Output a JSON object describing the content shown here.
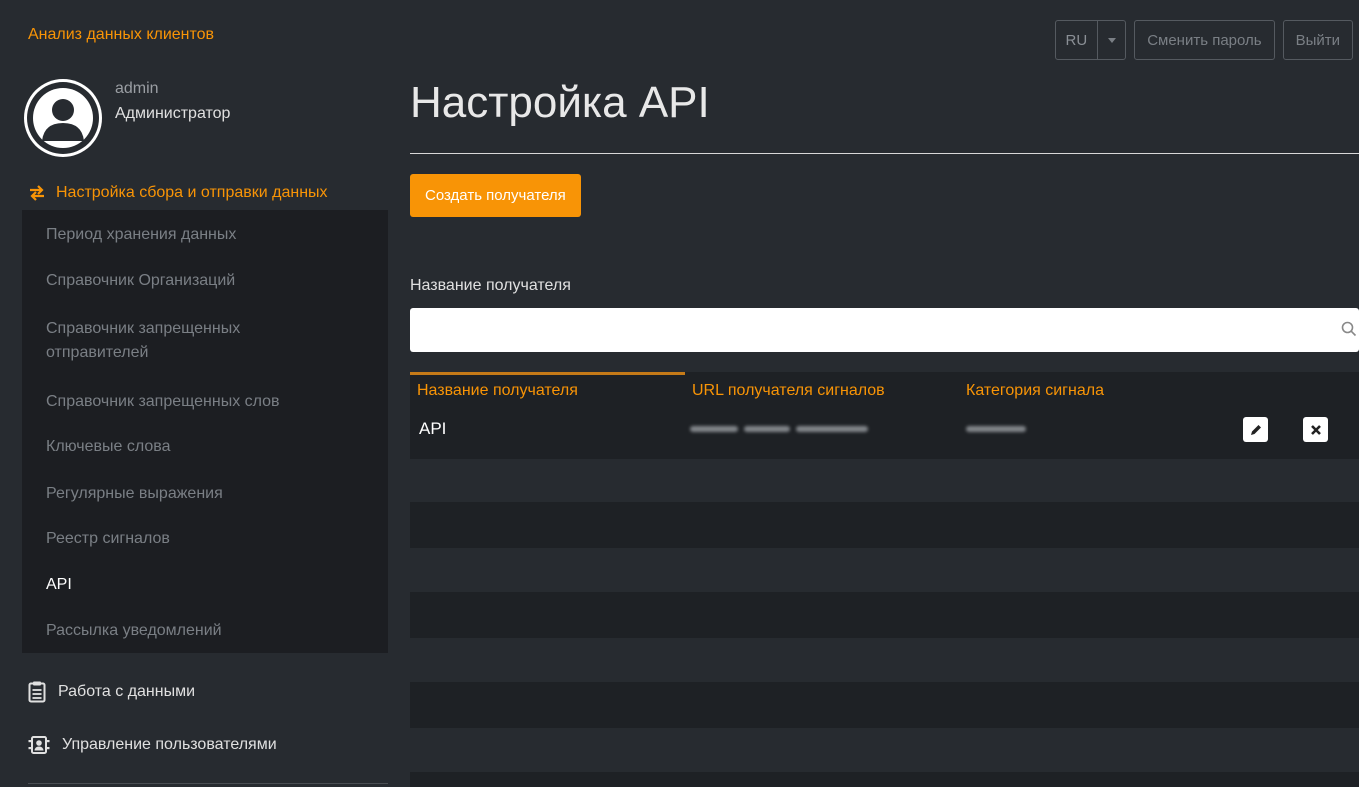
{
  "app": {
    "title": "Анализ данных клиентов"
  },
  "header": {
    "language": "RU",
    "change_password": "Сменить пароль",
    "logout": "Выйти"
  },
  "user": {
    "name": "admin",
    "role": "Администратор"
  },
  "sidebar": {
    "section_title": "Настройка сбора и отправки данных",
    "submenu": [
      {
        "label": "Период хранения данных",
        "active": false
      },
      {
        "label": "Справочник Организаций",
        "active": false
      },
      {
        "label": "Справочник запрещенных отправителей",
        "active": false
      },
      {
        "label": "Справочник запрещенных слов",
        "active": false
      },
      {
        "label": "Ключевые слова",
        "active": false
      },
      {
        "label": "Регулярные выражения",
        "active": false
      },
      {
        "label": "Реестр сигналов",
        "active": false
      },
      {
        "label": "API",
        "active": true
      },
      {
        "label": "Рассылка уведомлений",
        "active": false
      }
    ],
    "items": [
      {
        "label": "Работа с данными",
        "icon": "clipboard-list-icon"
      },
      {
        "label": "Управление пользователями",
        "icon": "users-icon"
      }
    ]
  },
  "main": {
    "title": "Настройка API",
    "create_button": "Создать получателя",
    "filter_label": "Название получателя",
    "search_placeholder": "",
    "table": {
      "columns": [
        "Название получателя",
        "URL получателя сигналов",
        "Категория сигнала"
      ],
      "rows": [
        {
          "name": "API",
          "url": "",
          "category": ""
        }
      ]
    }
  },
  "colors": {
    "accent": "#f89406",
    "background": "#272b30",
    "submenu_bg": "#1c1e22"
  }
}
